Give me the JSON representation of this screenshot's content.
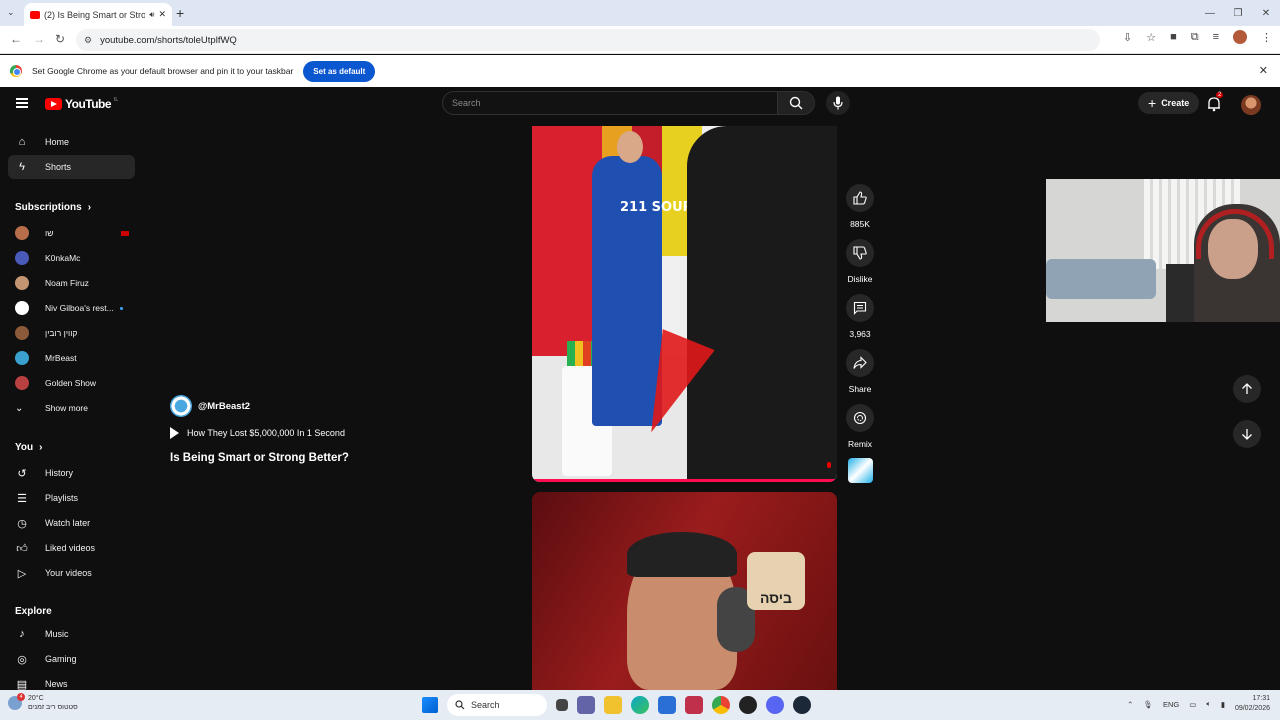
{
  "browser": {
    "tab_title": "(2) Is Being Smart or Stror",
    "url": "youtube.com/shorts/toleUtplfWQ",
    "infobar_message": "Set Google Chrome as your default browser and pin it to your taskbar",
    "infobar_button": "Set as default"
  },
  "header": {
    "logo_text": "YouTube",
    "logo_country": "IL",
    "search_placeholder": "Search",
    "create_label": "Create",
    "notification_count": "2"
  },
  "sidebar": {
    "main": [
      {
        "label": "Home",
        "icon": "home-icon"
      },
      {
        "label": "Shorts",
        "icon": "shorts-icon"
      }
    ],
    "subscriptions_heading": "Subscriptions",
    "subscriptions": [
      {
        "label": "שו",
        "color": "#b86e4a"
      },
      {
        "label": "K0nkaMc",
        "color": "#4a5ab8"
      },
      {
        "label": "Noam Firuz",
        "color": "#c49572"
      },
      {
        "label": "Niv Gilboa's rest...",
        "color": "#ffffff"
      },
      {
        "label": "קווין רובין",
        "color": "#8a5a3a"
      },
      {
        "label": "MrBeast",
        "color": "#3aa0d0"
      },
      {
        "label": "Golden Show",
        "color": "#b84040"
      }
    ],
    "show_more": "Show more",
    "you_heading": "You",
    "you_items": [
      {
        "label": "History",
        "icon": "history-icon"
      },
      {
        "label": "Playlists",
        "icon": "playlists-icon"
      },
      {
        "label": "Watch later",
        "icon": "watch-later-icon"
      },
      {
        "label": "Liked videos",
        "icon": "liked-videos-icon"
      },
      {
        "label": "Your videos",
        "icon": "your-videos-icon"
      }
    ],
    "explore_heading": "Explore",
    "explore_items": [
      {
        "label": "Music",
        "icon": "music-icon"
      },
      {
        "label": "Gaming",
        "icon": "gaming-icon"
      },
      {
        "label": "News",
        "icon": "news-icon"
      }
    ]
  },
  "short": {
    "channel": "@MrBeast2",
    "linked_video": "How They Lost $5,000,000 In 1 Second",
    "title": "Is Being Smart or Strong Better?",
    "shirt_text": "211 SOUP",
    "next_sticker_text": "ביסה"
  },
  "actions": {
    "likes": "885K",
    "dislike": "Dislike",
    "comments": "3,963",
    "share": "Share",
    "remix": "Remix"
  },
  "taskbar": {
    "weather_temp": "20°C",
    "weather_desc": "סטטוס ריב זמנים",
    "weather_badge": "4",
    "search_label": "Search",
    "lang": "ENG",
    "time": "17:31",
    "date": "09/02/2026"
  }
}
